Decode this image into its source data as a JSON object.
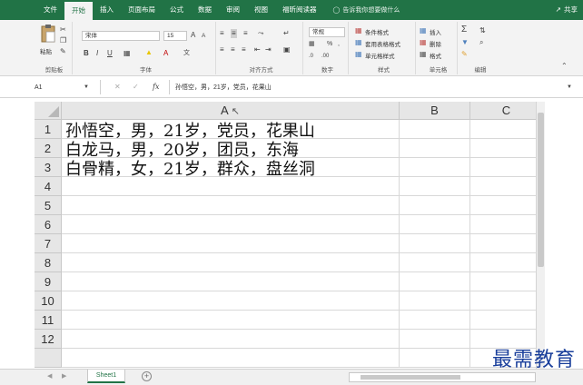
{
  "tabs": [
    "文件",
    "开始",
    "插入",
    "页面布局",
    "公式",
    "数据",
    "审阅",
    "视图",
    "福昕阅读器"
  ],
  "active_tab": "开始",
  "tell_me": "告诉我你想要做什么",
  "share_label": "共享",
  "ribbon": {
    "paste_label": "粘贴",
    "font_name": "宋体",
    "font_size": "15",
    "number_format": "常规",
    "conditional_format": "条件格式",
    "table_format": "套用表格格式",
    "cell_style": "单元格样式",
    "insert": "插入",
    "delete": "删除",
    "format": "格式",
    "groups": {
      "clipboard": "剪贴板",
      "font": "字体",
      "alignment": "对齐方式",
      "number": "数字",
      "styles": "样式",
      "cells": "单元格",
      "editing": "编辑"
    }
  },
  "formula_bar": {
    "name_box": "A1",
    "fx_label": "fx",
    "formula": "孙悟空，男，21岁，党员，花果山"
  },
  "columns": [
    "A",
    "B",
    "C"
  ],
  "rows": [
    "1",
    "2",
    "3",
    "4",
    "5",
    "6",
    "7",
    "8",
    "9",
    "10",
    "11",
    "12"
  ],
  "cells": [
    "孙悟空，男，21岁，党员，花果山",
    "白龙马，男，20岁，团员，东海",
    "白骨精，女，21岁，群众，盘丝洞"
  ],
  "sheet_tab": "Sheet1",
  "watermark": "最需教育",
  "colors": {
    "excel_green": "#217346",
    "header_gray": "#e6e6e6",
    "watermark_blue": "#1a3f9b"
  }
}
